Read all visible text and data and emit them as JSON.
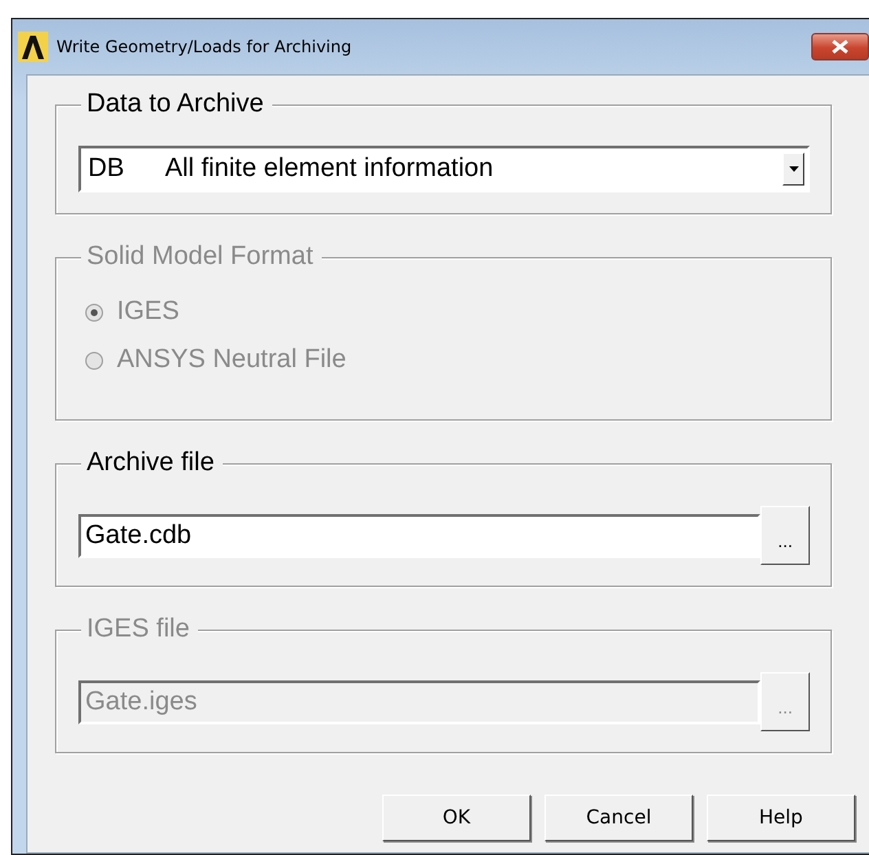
{
  "window": {
    "title": "Write Geometry/Loads for Archiving"
  },
  "groups": [
    {
      "kind": "dropdown",
      "legend": "Data to Archive",
      "disabled": false,
      "code": "DB",
      "value": "All finite element information"
    },
    {
      "kind": "radio",
      "legend": "Solid Model Format",
      "disabled": true,
      "options": [
        {
          "label": "IGES",
          "selected": true
        },
        {
          "label": "ANSYS Neutral File",
          "selected": false
        }
      ]
    },
    {
      "kind": "file",
      "legend": "Archive file",
      "disabled": false,
      "value": "Gate.cdb",
      "browse": "..."
    },
    {
      "kind": "file",
      "legend": "IGES file",
      "disabled": true,
      "value": "Gate.iges",
      "browse": "..."
    }
  ],
  "buttons": [
    "OK",
    "Cancel",
    "Help"
  ]
}
